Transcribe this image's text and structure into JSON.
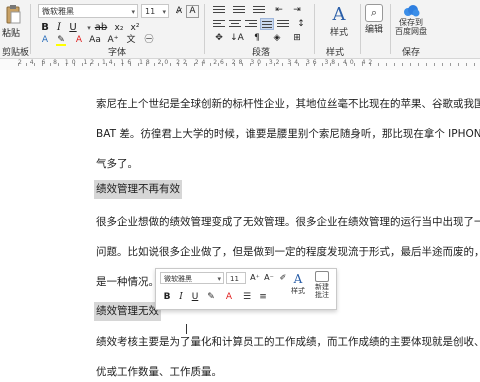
{
  "ribbon": {
    "clipboard": {
      "label": "粘贴",
      "group_label": "剪贴板"
    },
    "font": {
      "name": "微软雅黑",
      "size": "11",
      "group_label": "字体"
    },
    "paragraph": {
      "group_label": "段落"
    },
    "styles": {
      "button_label": "样式",
      "group_label": "样式"
    },
    "editing": {
      "button_label": "编辑"
    },
    "save": {
      "button_label_line1": "保存到",
      "button_label_line2": "百度网盘",
      "group_label": "保存"
    }
  },
  "ruler": {
    "numbers": "2 4 6 8 10 12 14 16 18 20 22 24 26 28 30 32 34 36 38 40 42"
  },
  "document": {
    "lines": [
      "索尼在上个世纪是全球创新的标杆性企业，其地位丝毫不比现在的苹果、谷歌或我国",
      "BAT 差。彷徨君上大学的时候，谁要是腰里别个索尼随身听，那比现在拿个 IPHONE",
      "气多了。",
      "绩效管理不再有效",
      "很多企业想做的绩效管理变成了无效管理。很多企业在绩效管理的运行当中出现了一",
      "问题。比如说很多企业做了，但是做到一定的程度发现流于形式，最后半途而废的，",
      "是一种情况。",
      "绩效管理无效",
      "绩效考核主要是为了量化和计算员工的工作成绩，而工作成绩的主要体现就是创收、",
      "优或工作数量、工作质量。"
    ]
  },
  "mini_toolbar": {
    "font_name": "微软雅黑",
    "font_size": "11",
    "styles_label": "样式",
    "comment_label_line1": "新建",
    "comment_label_line2": "批注"
  },
  "colors": {
    "highlight": "#ffff00",
    "font_color": "#e02020",
    "heading_bg": "#d6d6d6"
  }
}
